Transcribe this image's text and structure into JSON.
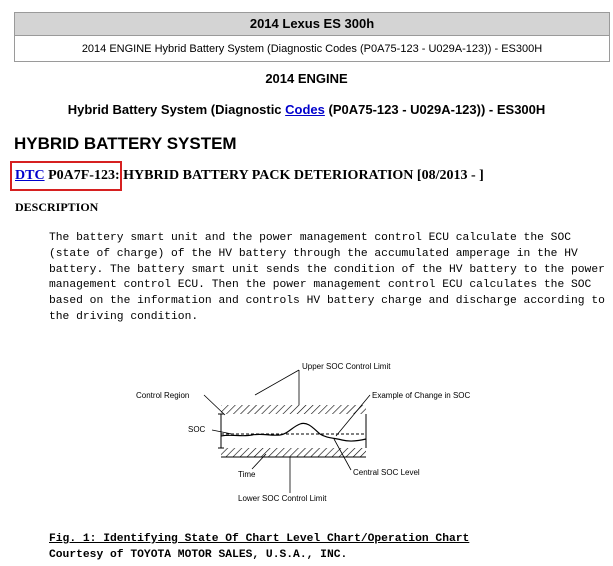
{
  "header": {
    "title": "2014 Lexus ES 300h",
    "subtitle": "2014 ENGINE Hybrid Battery System (Diagnostic Codes (P0A75-123 - U029A-123)) - ES300H"
  },
  "document": {
    "engine_heading": "2014 ENGINE",
    "title_prefix": "Hybrid Battery System (Diagnostic ",
    "title_link": "Codes",
    "title_suffix": " (P0A75-123 - U029A-123)) - ES300H",
    "section_heading": "HYBRID BATTERY SYSTEM",
    "dtc_link": "DTC",
    "dtc_code": " P0A7F-123:",
    "dtc_title": " HYBRID BATTERY PACK DETERIORATION [08/2013 - ]",
    "description_label": "DESCRIPTION",
    "description_lines": [
      "The battery smart unit and the power management control ECU calculate the SOC",
      "(state of charge) of the HV battery through the accumulated amperage in the HV",
      "battery. The battery smart unit sends the condition of the HV battery to the power",
      "management control ECU. Then the power management control ECU calculates the SOC",
      "based on the information and controls HV battery charge and discharge according to",
      "the driving condition."
    ]
  },
  "diagram": {
    "upper_limit_label": "Upper SOC Control Limit",
    "control_region_label": "Control Region",
    "example_change_label": "Example of Change in SOC",
    "soc_label": "SOC",
    "time_label": "Time",
    "central_level_label": "Central SOC Level",
    "lower_limit_label": "Lower SOC Control Limit"
  },
  "figure": {
    "caption": "Fig. 1: Identifying State Of Chart Level Chart/Operation Chart",
    "courtesy": "Courtesy of TOYOTA MOTOR SALES, U.S.A., INC."
  },
  "colors": {
    "link": "#0000cc",
    "highlight_border": "#d62020",
    "header_bar": "#d4d4d4"
  }
}
